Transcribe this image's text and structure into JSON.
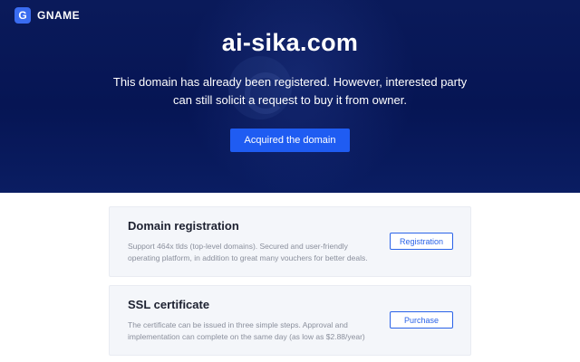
{
  "brand": {
    "name": "GNAME",
    "logo_letter": "G"
  },
  "hero": {
    "domain": "ai-sika.com",
    "description": "This domain has already been registered. However, interested party can still solicit a request to buy it from owner.",
    "cta_label": "Acquired the domain"
  },
  "cards": [
    {
      "title": "Domain registration",
      "description": "Support 464x tlds (top-level domains). Secured and user-friendly operating platform, in addition to great many vouchers for better deals.",
      "button_label": "Registration"
    },
    {
      "title": "SSL certificate",
      "description": "The certificate can be issued in three simple steps. Approval and implementation can complete on the same day (as low as $2.88/year)",
      "button_label": "Purchase"
    }
  ],
  "colors": {
    "hero_bg": "#061554",
    "accent": "#1f5cf2",
    "card_bg": "#f4f6fa"
  }
}
